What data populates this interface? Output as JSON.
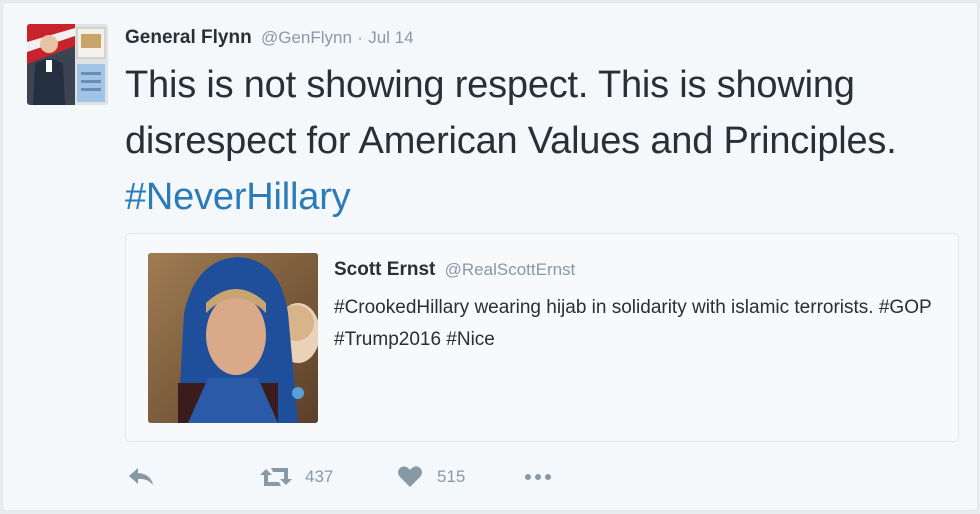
{
  "tweet": {
    "author_name": "General Flynn",
    "author_handle": "@GenFlynn",
    "separator": "·",
    "date": "Jul 14",
    "text_before": "This is not showing respect. This is showing disrespect for American Values and Principles. ",
    "hashtag": "#NeverHillary"
  },
  "quote": {
    "author_name": "Scott Ernst",
    "author_handle": "@RealScottErnst",
    "text": "#CrookedHillary wearing hijab in solidarity with islamic terrorists.  #GOP #Trump2016 #Nice"
  },
  "actions": {
    "retweet_count": "437",
    "like_count": "515"
  },
  "icons": {
    "reply": "reply-icon",
    "retweet": "retweet-icon",
    "like": "heart-icon",
    "more": "more-dots-icon"
  },
  "colors": {
    "link": "#2b7bb9",
    "muted": "#8899a6",
    "text": "#292f33",
    "background": "#f5f8fa"
  }
}
